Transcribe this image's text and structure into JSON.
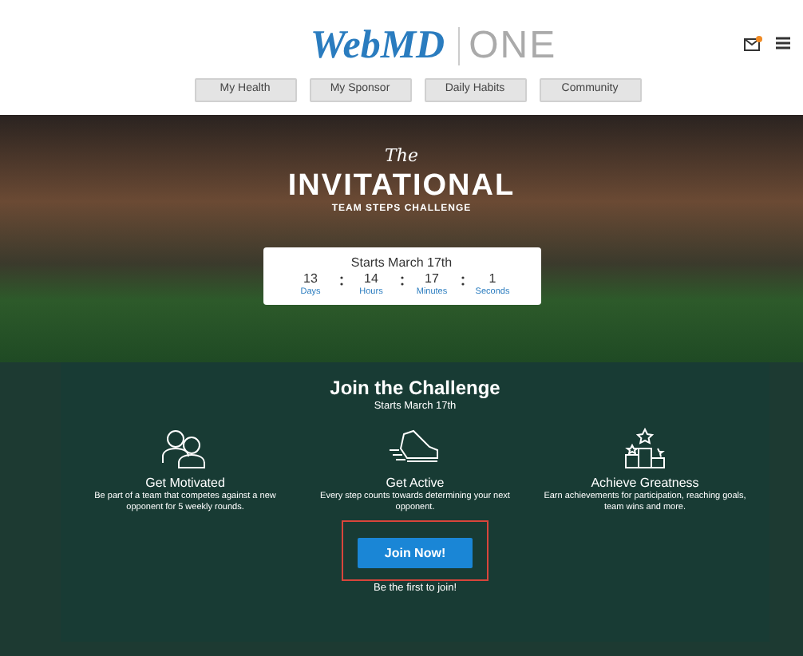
{
  "header": {
    "logo_primary": "WebMD",
    "logo_secondary": "ONE",
    "has_notification": true
  },
  "nav": [
    {
      "label": "My Health"
    },
    {
      "label": "My Sponsor"
    },
    {
      "label": "Daily Habits"
    },
    {
      "label": "Community"
    }
  ],
  "hero": {
    "pretitle": "The",
    "title": "INVITATIONAL",
    "subtitle": "TEAM STEPS CHALLENGE"
  },
  "countdown": {
    "title": "Starts March 17th",
    "units": [
      {
        "value": "13",
        "label": "Days"
      },
      {
        "value": "14",
        "label": "Hours"
      },
      {
        "value": "17",
        "label": "Minutes"
      },
      {
        "value": "1",
        "label": "Seconds"
      }
    ]
  },
  "challenge": {
    "title": "Join the Challenge",
    "subtitle": "Starts March 17th",
    "features": [
      {
        "kind": "team",
        "title": "Get Motivated",
        "text": "Be part of a team that competes against a new opponent for 5 weekly rounds."
      },
      {
        "kind": "shoe",
        "title": "Get Active",
        "text": "Every step counts towards determining your next opponent."
      },
      {
        "kind": "podium",
        "title": "Achieve Greatness",
        "text": "Earn achievements for participation, reaching goals, team wins and more."
      }
    ],
    "button": "Join Now!",
    "button_highlighted": true,
    "note": "Be the first to join!"
  }
}
